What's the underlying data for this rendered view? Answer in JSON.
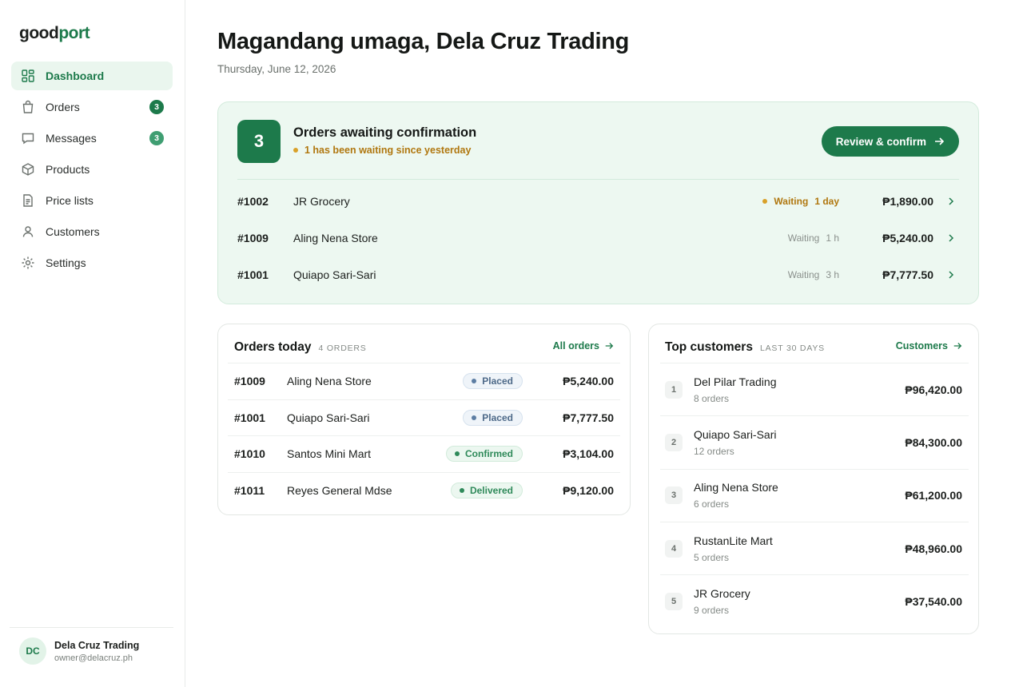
{
  "brand": {
    "part1": "good",
    "part2": "port"
  },
  "nav": [
    {
      "label": "Dashboard",
      "icon": "dashboard-icon",
      "active": true
    },
    {
      "label": "Orders",
      "icon": "bag-icon",
      "badge": "3"
    },
    {
      "label": "Messages",
      "icon": "message-icon",
      "badge": "3"
    },
    {
      "label": "Products",
      "icon": "box-icon"
    },
    {
      "label": "Price lists",
      "icon": "document-icon"
    },
    {
      "label": "Customers",
      "icon": "user-icon"
    },
    {
      "label": "Settings",
      "icon": "gear-icon"
    }
  ],
  "user": {
    "initials": "DC",
    "name": "Dela Cruz Trading",
    "email": "owner@delacruz.ph"
  },
  "header": {
    "greeting": "Magandang umaga, Dela Cruz Trading",
    "date": "Thursday, June 12, 2026"
  },
  "awaiting": {
    "count": "3",
    "title": "Orders awaiting confirmation",
    "subtitle": "1 has been waiting since yesterday",
    "button": "Review & confirm",
    "rows": [
      {
        "id": "#1002",
        "name": "JR Grocery",
        "wait_label": "Waiting",
        "wait_value": "1 day",
        "amount": "₱1,890.00",
        "urgent": true
      },
      {
        "id": "#1009",
        "name": "Aling Nena Store",
        "wait_label": "Waiting",
        "wait_value": "1 h",
        "amount": "₱5,240.00",
        "urgent": false
      },
      {
        "id": "#1001",
        "name": "Quiapo Sari-Sari",
        "wait_label": "Waiting",
        "wait_value": "3 h",
        "amount": "₱7,777.50",
        "urgent": false
      }
    ]
  },
  "orders_today": {
    "title": "Orders today",
    "meta": "4 ORDERS",
    "link": "All orders",
    "rows": [
      {
        "id": "#1009",
        "name": "Aling Nena Store",
        "status": "Placed",
        "amount": "₱5,240.00"
      },
      {
        "id": "#1001",
        "name": "Quiapo Sari-Sari",
        "status": "Placed",
        "amount": "₱7,777.50"
      },
      {
        "id": "#1010",
        "name": "Santos Mini Mart",
        "status": "Confirmed",
        "amount": "₱3,104.00"
      },
      {
        "id": "#1011",
        "name": "Reyes General Mdse",
        "status": "Delivered",
        "amount": "₱9,120.00"
      }
    ]
  },
  "top_customers": {
    "title": "Top customers",
    "meta": "LAST 30 DAYS",
    "link": "Customers",
    "rows": [
      {
        "rank": "1",
        "name": "Del Pilar Trading",
        "orders": "8 orders",
        "amount": "₱96,420.00"
      },
      {
        "rank": "2",
        "name": "Quiapo Sari-Sari",
        "orders": "12 orders",
        "amount": "₱84,300.00"
      },
      {
        "rank": "3",
        "name": "Aling Nena Store",
        "orders": "6 orders",
        "amount": "₱61,200.00"
      },
      {
        "rank": "4",
        "name": "RustanLite Mart",
        "orders": "5 orders",
        "amount": "₱48,960.00"
      },
      {
        "rank": "5",
        "name": "JR Grocery",
        "orders": "9 orders",
        "amount": "₱37,540.00"
      }
    ]
  },
  "colors": {
    "accent": "#1d7a4b",
    "accent_light": "#edf8f1",
    "warning": "#b0770f",
    "placed": "#5c7da3"
  }
}
